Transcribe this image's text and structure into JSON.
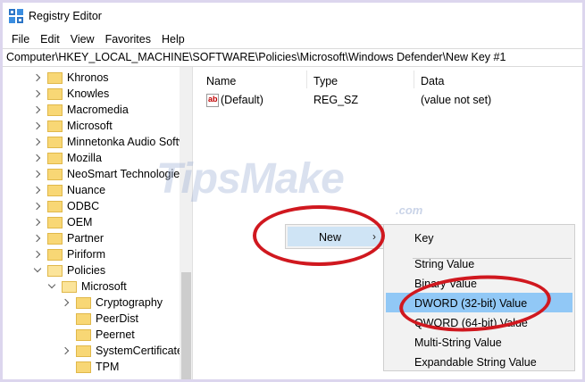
{
  "window": {
    "title": "Registry Editor"
  },
  "menubar": {
    "items": [
      {
        "label": "File"
      },
      {
        "label": "Edit"
      },
      {
        "label": "View"
      },
      {
        "label": "Favorites"
      },
      {
        "label": "Help"
      }
    ]
  },
  "address": {
    "path": "Computer\\HKEY_LOCAL_MACHINE\\SOFTWARE\\Policies\\Microsoft\\Windows Defender\\New Key #1"
  },
  "tree": {
    "items": [
      {
        "label": "Khronos"
      },
      {
        "label": "Knowles"
      },
      {
        "label": "Macromedia"
      },
      {
        "label": "Microsoft"
      },
      {
        "label": "Minnetonka Audio Softw"
      },
      {
        "label": "Mozilla"
      },
      {
        "label": "NeoSmart Technologies"
      },
      {
        "label": "Nuance"
      },
      {
        "label": "ODBC"
      },
      {
        "label": "OEM"
      },
      {
        "label": "Partner"
      },
      {
        "label": "Piriform"
      },
      {
        "label": "Policies"
      },
      {
        "label": "Microsoft"
      },
      {
        "label": "Cryptography"
      },
      {
        "label": "PeerDist"
      },
      {
        "label": "Peernet"
      },
      {
        "label": "SystemCertificates"
      },
      {
        "label": "TPM"
      }
    ]
  },
  "list": {
    "columns": {
      "name": "Name",
      "type": "Type",
      "data": "Data"
    },
    "rows": [
      {
        "name": "(Default)",
        "type": "REG_SZ",
        "data": "(value not set)",
        "icon": "ab-icon"
      }
    ]
  },
  "watermark": {
    "text": "TipsMake",
    "domain": ".com"
  },
  "context_menu": {
    "new_label": "New",
    "submenu": [
      {
        "label": "Key"
      },
      {
        "label": "String Value"
      },
      {
        "label": "Binary Value"
      },
      {
        "label": "DWORD (32-bit) Value"
      },
      {
        "label": "QWORD (64-bit) Value"
      },
      {
        "label": "Multi-String Value"
      },
      {
        "label": "Expandable String Value"
      }
    ]
  },
  "colors": {
    "highlight": "#91c8f6",
    "annotation": "#d0181f",
    "folder": "#f8d775"
  }
}
